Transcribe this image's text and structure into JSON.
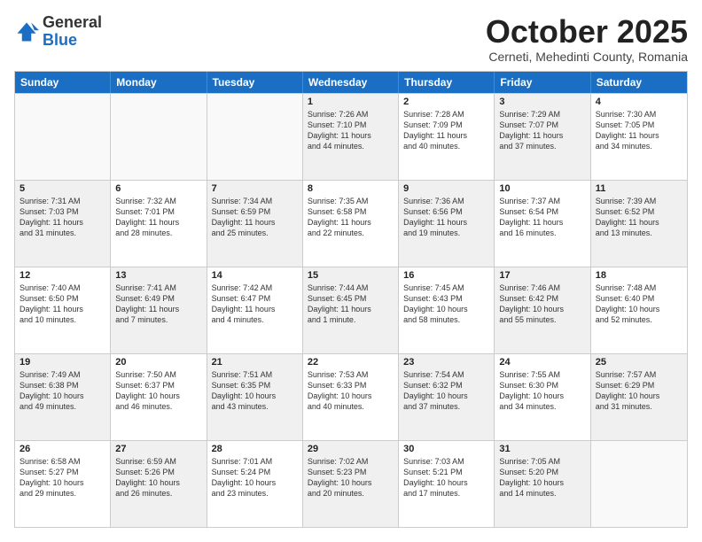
{
  "header": {
    "logo_general": "General",
    "logo_blue": "Blue",
    "month": "October 2025",
    "location": "Cerneti, Mehedinti County, Romania"
  },
  "weekdays": [
    "Sunday",
    "Monday",
    "Tuesday",
    "Wednesday",
    "Thursday",
    "Friday",
    "Saturday"
  ],
  "rows": [
    [
      {
        "day": "",
        "lines": [],
        "empty": true
      },
      {
        "day": "",
        "lines": [],
        "empty": true
      },
      {
        "day": "",
        "lines": [],
        "empty": true
      },
      {
        "day": "1",
        "lines": [
          "Sunrise: 7:26 AM",
          "Sunset: 7:10 PM",
          "Daylight: 11 hours",
          "and 44 minutes."
        ],
        "shaded": true
      },
      {
        "day": "2",
        "lines": [
          "Sunrise: 7:28 AM",
          "Sunset: 7:09 PM",
          "Daylight: 11 hours",
          "and 40 minutes."
        ],
        "shaded": false
      },
      {
        "day": "3",
        "lines": [
          "Sunrise: 7:29 AM",
          "Sunset: 7:07 PM",
          "Daylight: 11 hours",
          "and 37 minutes."
        ],
        "shaded": true
      },
      {
        "day": "4",
        "lines": [
          "Sunrise: 7:30 AM",
          "Sunset: 7:05 PM",
          "Daylight: 11 hours",
          "and 34 minutes."
        ],
        "shaded": false
      }
    ],
    [
      {
        "day": "5",
        "lines": [
          "Sunrise: 7:31 AM",
          "Sunset: 7:03 PM",
          "Daylight: 11 hours",
          "and 31 minutes."
        ],
        "shaded": true
      },
      {
        "day": "6",
        "lines": [
          "Sunrise: 7:32 AM",
          "Sunset: 7:01 PM",
          "Daylight: 11 hours",
          "and 28 minutes."
        ],
        "shaded": false
      },
      {
        "day": "7",
        "lines": [
          "Sunrise: 7:34 AM",
          "Sunset: 6:59 PM",
          "Daylight: 11 hours",
          "and 25 minutes."
        ],
        "shaded": true
      },
      {
        "day": "8",
        "lines": [
          "Sunrise: 7:35 AM",
          "Sunset: 6:58 PM",
          "Daylight: 11 hours",
          "and 22 minutes."
        ],
        "shaded": false
      },
      {
        "day": "9",
        "lines": [
          "Sunrise: 7:36 AM",
          "Sunset: 6:56 PM",
          "Daylight: 11 hours",
          "and 19 minutes."
        ],
        "shaded": true
      },
      {
        "day": "10",
        "lines": [
          "Sunrise: 7:37 AM",
          "Sunset: 6:54 PM",
          "Daylight: 11 hours",
          "and 16 minutes."
        ],
        "shaded": false
      },
      {
        "day": "11",
        "lines": [
          "Sunrise: 7:39 AM",
          "Sunset: 6:52 PM",
          "Daylight: 11 hours",
          "and 13 minutes."
        ],
        "shaded": true
      }
    ],
    [
      {
        "day": "12",
        "lines": [
          "Sunrise: 7:40 AM",
          "Sunset: 6:50 PM",
          "Daylight: 11 hours",
          "and 10 minutes."
        ],
        "shaded": false
      },
      {
        "day": "13",
        "lines": [
          "Sunrise: 7:41 AM",
          "Sunset: 6:49 PM",
          "Daylight: 11 hours",
          "and 7 minutes."
        ],
        "shaded": true
      },
      {
        "day": "14",
        "lines": [
          "Sunrise: 7:42 AM",
          "Sunset: 6:47 PM",
          "Daylight: 11 hours",
          "and 4 minutes."
        ],
        "shaded": false
      },
      {
        "day": "15",
        "lines": [
          "Sunrise: 7:44 AM",
          "Sunset: 6:45 PM",
          "Daylight: 11 hours",
          "and 1 minute."
        ],
        "shaded": true
      },
      {
        "day": "16",
        "lines": [
          "Sunrise: 7:45 AM",
          "Sunset: 6:43 PM",
          "Daylight: 10 hours",
          "and 58 minutes."
        ],
        "shaded": false
      },
      {
        "day": "17",
        "lines": [
          "Sunrise: 7:46 AM",
          "Sunset: 6:42 PM",
          "Daylight: 10 hours",
          "and 55 minutes."
        ],
        "shaded": true
      },
      {
        "day": "18",
        "lines": [
          "Sunrise: 7:48 AM",
          "Sunset: 6:40 PM",
          "Daylight: 10 hours",
          "and 52 minutes."
        ],
        "shaded": false
      }
    ],
    [
      {
        "day": "19",
        "lines": [
          "Sunrise: 7:49 AM",
          "Sunset: 6:38 PM",
          "Daylight: 10 hours",
          "and 49 minutes."
        ],
        "shaded": true
      },
      {
        "day": "20",
        "lines": [
          "Sunrise: 7:50 AM",
          "Sunset: 6:37 PM",
          "Daylight: 10 hours",
          "and 46 minutes."
        ],
        "shaded": false
      },
      {
        "day": "21",
        "lines": [
          "Sunrise: 7:51 AM",
          "Sunset: 6:35 PM",
          "Daylight: 10 hours",
          "and 43 minutes."
        ],
        "shaded": true
      },
      {
        "day": "22",
        "lines": [
          "Sunrise: 7:53 AM",
          "Sunset: 6:33 PM",
          "Daylight: 10 hours",
          "and 40 minutes."
        ],
        "shaded": false
      },
      {
        "day": "23",
        "lines": [
          "Sunrise: 7:54 AM",
          "Sunset: 6:32 PM",
          "Daylight: 10 hours",
          "and 37 minutes."
        ],
        "shaded": true
      },
      {
        "day": "24",
        "lines": [
          "Sunrise: 7:55 AM",
          "Sunset: 6:30 PM",
          "Daylight: 10 hours",
          "and 34 minutes."
        ],
        "shaded": false
      },
      {
        "day": "25",
        "lines": [
          "Sunrise: 7:57 AM",
          "Sunset: 6:29 PM",
          "Daylight: 10 hours",
          "and 31 minutes."
        ],
        "shaded": true
      }
    ],
    [
      {
        "day": "26",
        "lines": [
          "Sunrise: 6:58 AM",
          "Sunset: 5:27 PM",
          "Daylight: 10 hours",
          "and 29 minutes."
        ],
        "shaded": false
      },
      {
        "day": "27",
        "lines": [
          "Sunrise: 6:59 AM",
          "Sunset: 5:26 PM",
          "Daylight: 10 hours",
          "and 26 minutes."
        ],
        "shaded": true
      },
      {
        "day": "28",
        "lines": [
          "Sunrise: 7:01 AM",
          "Sunset: 5:24 PM",
          "Daylight: 10 hours",
          "and 23 minutes."
        ],
        "shaded": false
      },
      {
        "day": "29",
        "lines": [
          "Sunrise: 7:02 AM",
          "Sunset: 5:23 PM",
          "Daylight: 10 hours",
          "and 20 minutes."
        ],
        "shaded": true
      },
      {
        "day": "30",
        "lines": [
          "Sunrise: 7:03 AM",
          "Sunset: 5:21 PM",
          "Daylight: 10 hours",
          "and 17 minutes."
        ],
        "shaded": false
      },
      {
        "day": "31",
        "lines": [
          "Sunrise: 7:05 AM",
          "Sunset: 5:20 PM",
          "Daylight: 10 hours",
          "and 14 minutes."
        ],
        "shaded": true
      },
      {
        "day": "",
        "lines": [],
        "empty": true
      }
    ]
  ]
}
